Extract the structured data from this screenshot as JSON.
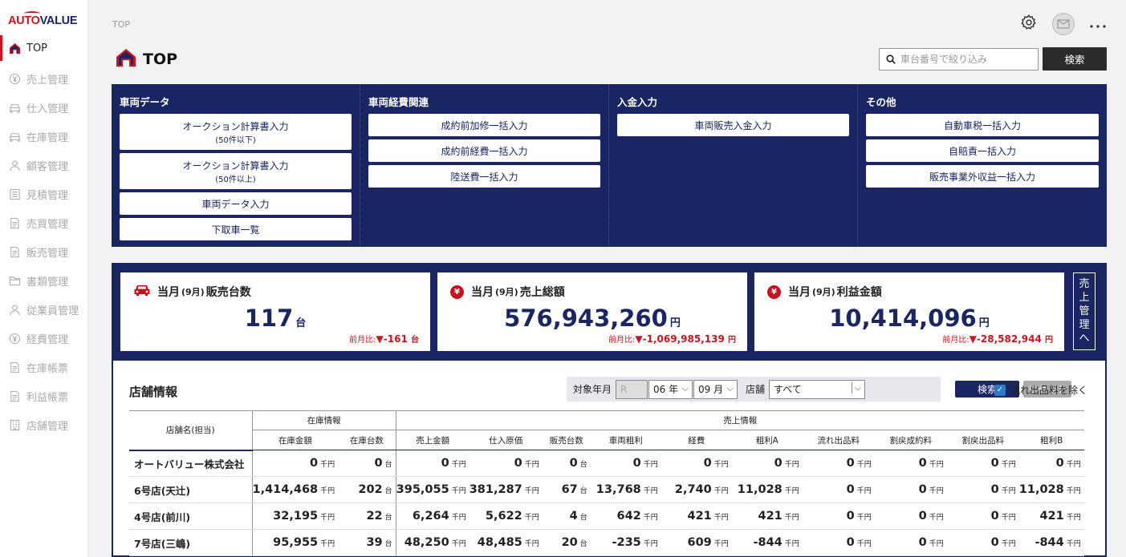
{
  "logo": {
    "part1": "AUTO",
    "part2": "VALUE"
  },
  "sidebar": {
    "items": [
      {
        "label": "TOP",
        "icon": "home-icon"
      },
      {
        "label": "売上管理",
        "icon": "yen-circle-icon"
      },
      {
        "label": "仕入管理",
        "icon": "car-icon"
      },
      {
        "label": "在庫管理",
        "icon": "car-icon"
      },
      {
        "label": "顧客管理",
        "icon": "person-icon"
      },
      {
        "label": "見積管理",
        "icon": "list-icon"
      },
      {
        "label": "売買管理",
        "icon": "document-icon"
      },
      {
        "label": "販売管理",
        "icon": "document-icon"
      },
      {
        "label": "書類管理",
        "icon": "folder-icon"
      },
      {
        "label": "従業員管理",
        "icon": "person-icon"
      },
      {
        "label": "経費管理",
        "icon": "yen-circle-icon"
      },
      {
        "label": "在庫帳票",
        "icon": "document-icon"
      },
      {
        "label": "利益帳票",
        "icon": "document-icon"
      },
      {
        "label": "店舗管理",
        "icon": "building-icon"
      }
    ]
  },
  "header": {
    "breadcrumb": "TOP",
    "title": "TOP",
    "search_placeholder": "車台番号で絞り込み",
    "search_button": "検索"
  },
  "menu": {
    "columns": [
      {
        "title": "車両データ",
        "buttons": [
          {
            "label": "オークション計算書入力",
            "sub": "(50件以下)"
          },
          {
            "label": "オークション計算書入力",
            "sub": "(50件以上)"
          },
          {
            "label": "車両データ入力",
            "sub": ""
          },
          {
            "label": "下取車一覧",
            "sub": ""
          }
        ]
      },
      {
        "title": "車両経費関連",
        "buttons": [
          {
            "label": "成約前加修一括入力",
            "sub": ""
          },
          {
            "label": "成約前経費一括入力",
            "sub": ""
          },
          {
            "label": "陸送費一括入力",
            "sub": ""
          }
        ]
      },
      {
        "title": "入金入力",
        "buttons": [
          {
            "label": "車両販売入金入力",
            "sub": ""
          }
        ]
      },
      {
        "title": "その他",
        "buttons": [
          {
            "label": "自動車税一括入力",
            "sub": ""
          },
          {
            "label": "自賠責一括入力",
            "sub": ""
          },
          {
            "label": "販売事業外収益一括入力",
            "sub": ""
          }
        ]
      }
    ]
  },
  "kpis": {
    "units": {
      "pre": "当月",
      "month": "(9月)",
      "name": "販売台数",
      "value": "117",
      "unit": "台",
      "cmp_label": "前月比:",
      "cmp_value": "-161",
      "cmp_unit": "台"
    },
    "sales": {
      "pre": "当月",
      "month": "(9月)",
      "name": "売上総額",
      "value": "576,943,260",
      "unit": "円",
      "cmp_label": "前月比:",
      "cmp_value": "-1,069,985,139",
      "cmp_unit": "円"
    },
    "profit": {
      "pre": "当月",
      "month": "(9月)",
      "name": "利益金額",
      "value": "10,414,096",
      "unit": "円",
      "cmp_label": "前月比:",
      "cmp_value": "-28,582,944",
      "cmp_unit": "円"
    },
    "link_chars": [
      "売",
      "上",
      "管",
      "理",
      "へ"
    ]
  },
  "store": {
    "title": "店舗情報",
    "filter": {
      "year_month_label": "対象年月",
      "era": "R",
      "year": "06 年",
      "month": "09 月",
      "store_label": "店舗",
      "store_value": "すべて",
      "search": "検索",
      "reset": "リセット",
      "exclude_label": "流れ出品料を除く"
    },
    "group_headers": {
      "name": "店舗名(担当)",
      "stock": "在庫情報",
      "sales": "売上情報"
    },
    "columns": [
      "在庫金額",
      "在庫台数",
      "売上金額",
      "仕入原価",
      "販売台数",
      "車両粗利",
      "経費",
      "粗利A",
      "流れ出品料",
      "割戻成約料",
      "割戻出品料",
      "粗利B"
    ],
    "units": [
      "千円",
      "台",
      "千円",
      "千円",
      "台",
      "千円",
      "千円",
      "千円",
      "千円",
      "千円",
      "千円",
      "千円"
    ],
    "rows": [
      {
        "name": "オートバリュー株式会社",
        "values": [
          "0",
          "0",
          "0",
          "0",
          "0",
          "0",
          "0",
          "0",
          "0",
          "0",
          "0",
          "0"
        ]
      },
      {
        "name": "6号店(天辻)",
        "values": [
          "1,414,468",
          "202",
          "395,055",
          "381,287",
          "67",
          "13,768",
          "2,740",
          "11,028",
          "0",
          "0",
          "0",
          "11,028"
        ]
      },
      {
        "name": "4号店(前川)",
        "values": [
          "32,195",
          "22",
          "6,264",
          "5,622",
          "4",
          "642",
          "421",
          "421",
          "0",
          "0",
          "0",
          "421"
        ]
      },
      {
        "name": "7号店(三嶋)",
        "values": [
          "95,955",
          "39",
          "48,250",
          "48,485",
          "20",
          "-235",
          "609",
          "-844",
          "0",
          "0",
          "0",
          "-844"
        ]
      }
    ]
  },
  "colors": {
    "navy": "#1a2564",
    "red": "#d0121b"
  }
}
